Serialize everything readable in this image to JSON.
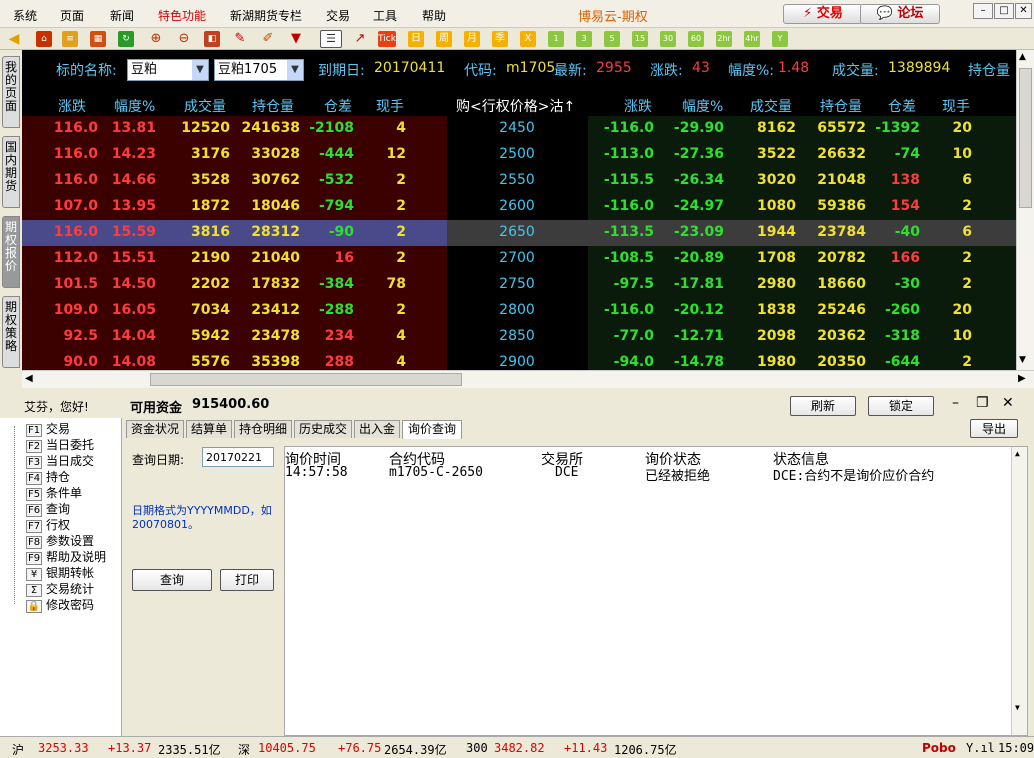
{
  "menu": [
    "系统",
    "页面",
    "新闻",
    "特色功能",
    "新湖期货专栏",
    "交易",
    "工具",
    "帮助"
  ],
  "app_title": "博易云-期权",
  "trade_btn": "⚡ 交易",
  "forum_btn": "💬 论坛",
  "win_btns": [
    "–",
    "□",
    "✕"
  ],
  "left_tabs": [
    "我的页面",
    "国内期货",
    "期权报价",
    "期权策略"
  ],
  "toolbar_text": {
    "tick": "Tick",
    "day": "日",
    "week": "周",
    "month": "月",
    "season": "季",
    "x": "X",
    "m1": "1",
    "m3": "3",
    "m5": "5",
    "m15": "15",
    "m30": "30",
    "m60": "60",
    "h2": "2hr",
    "h4": "4hr",
    "y": "Y"
  },
  "quote": {
    "name_label": "标的名称:",
    "name_value": "豆粕",
    "contract_value": "豆粕1705",
    "expiry_label": "到期日:",
    "expiry_value": "20170411",
    "code_label": "代码:",
    "code_value": "m1705",
    "latest_label": "最新:",
    "latest_value": "2955",
    "change_label": "涨跌:",
    "change_value": "43",
    "pct_label": "幅度%:",
    "pct_value": "1.48",
    "vol_label": "成交量:",
    "vol_value": "1389894",
    "oi_label": "持仓量"
  },
  "headers": {
    "left": [
      "涨跌",
      "幅度%",
      "成交量",
      "持仓量",
      "仓差",
      "现手"
    ],
    "center": "购<行权价格>沽↑",
    "right": [
      "涨跌",
      "幅度%",
      "成交量",
      "持仓量",
      "仓差",
      "现手"
    ]
  },
  "rows": [
    {
      "call": [
        "116.0",
        "13.81",
        "12520",
        "241638",
        "-2108",
        "4"
      ],
      "strike": "2450",
      "put": [
        "-116.0",
        "-29.90",
        "8162",
        "65572",
        "-1392",
        "20"
      ]
    },
    {
      "call": [
        "116.0",
        "14.23",
        "3176",
        "33028",
        "-444",
        "12"
      ],
      "strike": "2500",
      "put": [
        "-113.0",
        "-27.36",
        "3522",
        "26632",
        "-74",
        "10"
      ]
    },
    {
      "call": [
        "116.0",
        "14.66",
        "3528",
        "30762",
        "-532",
        "2"
      ],
      "strike": "2550",
      "put": [
        "-115.5",
        "-26.34",
        "3020",
        "21048",
        "138",
        "6"
      ]
    },
    {
      "call": [
        "107.0",
        "13.95",
        "1872",
        "18046",
        "-794",
        "2"
      ],
      "strike": "2600",
      "put": [
        "-116.0",
        "-24.97",
        "1080",
        "59386",
        "154",
        "2"
      ]
    },
    {
      "call": [
        "116.0",
        "15.59",
        "3816",
        "28312",
        "-90",
        "2"
      ],
      "strike": "2650",
      "put": [
        "-113.5",
        "-23.09",
        "1944",
        "23784",
        "-40",
        "6"
      ],
      "selected": true
    },
    {
      "call": [
        "112.0",
        "15.51",
        "2190",
        "21040",
        "16",
        "2"
      ],
      "strike": "2700",
      "put": [
        "-108.5",
        "-20.89",
        "1708",
        "20782",
        "166",
        "2"
      ]
    },
    {
      "call": [
        "101.5",
        "14.50",
        "2202",
        "17832",
        "-384",
        "78"
      ],
      "strike": "2750",
      "put": [
        "-97.5",
        "-17.81",
        "2980",
        "18660",
        "-30",
        "2"
      ]
    },
    {
      "call": [
        "109.0",
        "16.05",
        "7034",
        "23412",
        "-288",
        "2"
      ],
      "strike": "2800",
      "put": [
        "-116.0",
        "-20.12",
        "1838",
        "25246",
        "-260",
        "20"
      ]
    },
    {
      "call": [
        "92.5",
        "14.04",
        "5942",
        "23478",
        "234",
        "4"
      ],
      "strike": "2850",
      "put": [
        "-77.0",
        "-12.71",
        "2098",
        "20362",
        "-318",
        "10"
      ]
    },
    {
      "call": [
        "90.0",
        "14.08",
        "5576",
        "35398",
        "288",
        "4"
      ],
      "strike": "2900",
      "put": [
        "-94.0",
        "-14.78",
        "1980",
        "20350",
        "-644",
        "2"
      ]
    }
  ],
  "account": {
    "greeting": "艾芬，您好!",
    "funds_label": "可用资金",
    "funds_value": "915400.60",
    "refresh": "刷新",
    "lock": "锁定",
    "export": "导出"
  },
  "tree": [
    {
      "key": "F1",
      "label": "交易"
    },
    {
      "key": "F2",
      "label": "当日委托"
    },
    {
      "key": "F3",
      "label": "当日成交"
    },
    {
      "key": "F4",
      "label": "持仓"
    },
    {
      "key": "F5",
      "label": "条件单"
    },
    {
      "key": "F6",
      "label": "查询"
    },
    {
      "key": "F7",
      "label": "行权"
    },
    {
      "key": "F8",
      "label": "参数设置"
    },
    {
      "key": "F9",
      "label": "帮助及说明"
    },
    {
      "key": "¥",
      "label": "银期转帐"
    },
    {
      "key": "Σ",
      "label": "交易统计"
    },
    {
      "key": "🔒",
      "label": "修改密码"
    }
  ],
  "tabs": [
    "资金状况",
    "结算单",
    "持仓明细",
    "历史成交",
    "出入金",
    "询价查询"
  ],
  "query": {
    "date_label": "查询日期:",
    "date_value": "20170221",
    "hint": "日期格式为YYYYMMDD，如20070801。",
    "query_btn": "查询",
    "print_btn": "打印"
  },
  "result": {
    "headers": [
      "询价时间",
      "合约代码",
      "交易所",
      "询价状态",
      "状态信息"
    ],
    "row": [
      "14:57:58",
      "m1705-C-2650",
      "DCE",
      "已经被拒绝",
      "DCE:合约不是询价应价合约"
    ]
  },
  "status": {
    "sh_label": "沪",
    "sh_value": "3253.33",
    "sh_change": "+13.37",
    "sh_amount": "2335.51亿",
    "sz_label": "深",
    "sz_value": "10405.75",
    "sz_change": "+76.75",
    "sz_amount": "2654.39亿",
    "h300_label": "300",
    "h300_value": "3482.82",
    "h300_change": "+11.43",
    "h300_amount": "1206.75亿",
    "brand": "Pobo",
    "signal": "Y.ıl",
    "time": "15:09"
  },
  "colors": {
    "up": "#ff3b3b",
    "down": "#2ee02e",
    "yellow": "#f0e030",
    "cyan": "#40c8f0",
    "header": "#5cc6f5"
  }
}
